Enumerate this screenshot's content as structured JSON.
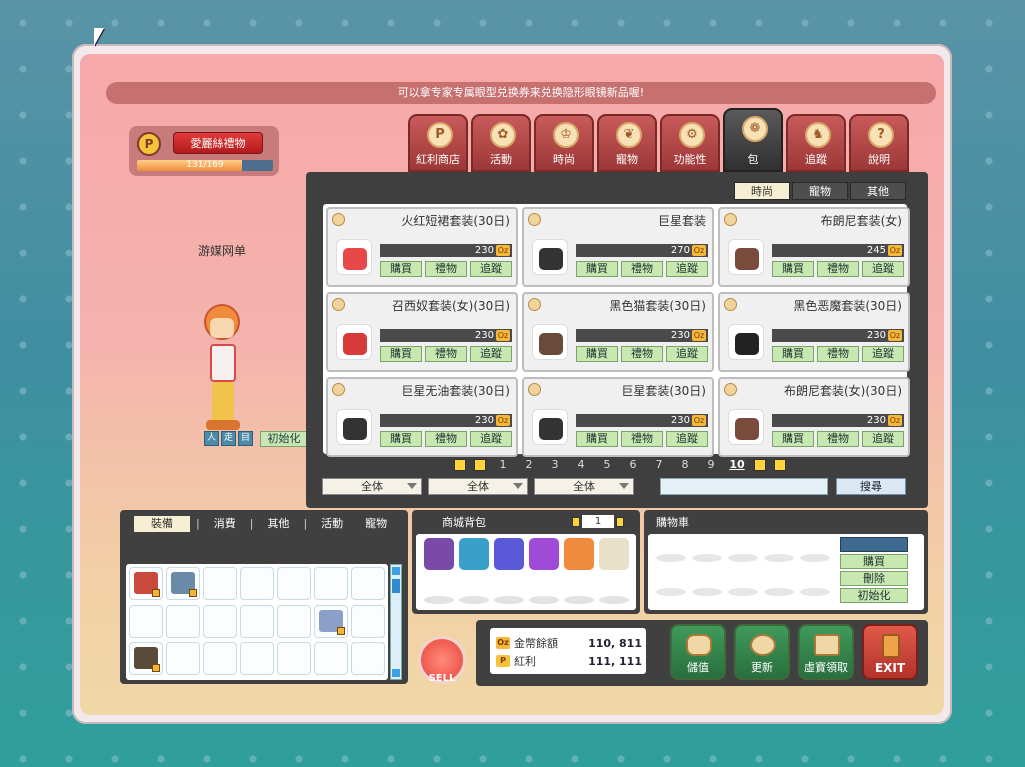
{
  "banner": "可以拿专家专属眼型兑换券来兑换隐形眼镜新品喔!",
  "gift": {
    "badge": "P",
    "label": "愛麗絲禮物",
    "gauge_text": "131/169",
    "gauge_progress": 0.775
  },
  "character": {
    "name": "游媒网单",
    "reset_label": "初始化",
    "controls": [
      "人",
      "走",
      "目"
    ]
  },
  "category_tabs": [
    {
      "label": "紅利商店",
      "glyph": "P"
    },
    {
      "label": "活動",
      "glyph": "✿"
    },
    {
      "label": "時尚",
      "glyph": "♔"
    },
    {
      "label": "寵物",
      "glyph": "❦"
    },
    {
      "label": "功能性",
      "glyph": "⚙"
    },
    {
      "label": "包",
      "glyph": "❁",
      "active": true
    },
    {
      "label": "追蹤",
      "glyph": "♞"
    },
    {
      "label": "說明",
      "glyph": "?"
    }
  ],
  "sub_tabs": [
    {
      "label": "時尚",
      "active": true
    },
    {
      "label": "寵物"
    },
    {
      "label": "其他"
    }
  ],
  "buttons": {
    "buy": "購買",
    "gift": "禮物",
    "track": "追蹤",
    "currency": "Oz"
  },
  "items": [
    {
      "name": "火红短裙套装(30日)",
      "price": "230",
      "color": "#e84848"
    },
    {
      "name": "巨星套装",
      "price": "270",
      "color": "#333333"
    },
    {
      "name": "布朗尼套装(女)",
      "price": "245",
      "color": "#7a4a3a"
    },
    {
      "name": "召西奴套装(女)(30日)",
      "price": "230",
      "color": "#d83a3a"
    },
    {
      "name": "黑色猫套装(30日)",
      "price": "230",
      "color": "#6a4a3a"
    },
    {
      "name": "黑色恶魔套装(30日)",
      "price": "230",
      "color": "#222222"
    },
    {
      "name": "巨星无油套装(30日)",
      "price": "230",
      "color": "#333333"
    },
    {
      "name": "巨星套装(30日)",
      "price": "230",
      "color": "#333333"
    },
    {
      "name": "布朗尼套装(女)(30日)",
      "price": "230",
      "color": "#7a4a3a"
    }
  ],
  "pager": {
    "pages": [
      "1",
      "2",
      "3",
      "4",
      "5",
      "6",
      "7",
      "8",
      "9",
      "10"
    ],
    "current": "10"
  },
  "filters": [
    "全体",
    "全体",
    "全体"
  ],
  "search": {
    "value": "",
    "button": "搜尋"
  },
  "inventory": {
    "tabs": [
      {
        "label": "裝備",
        "active": true
      },
      {
        "label": "消費"
      },
      {
        "label": "其他"
      },
      {
        "label": "活動"
      },
      {
        "label": "寵物"
      }
    ],
    "slots": [
      {
        "color": "#c94a3a"
      },
      {
        "color": "#6a8aa8"
      },
      {},
      {},
      {},
      {},
      {},
      {},
      {},
      {},
      {},
      {},
      {
        "color": "#8aa0c8"
      },
      {},
      {
        "color": "#5a4a3a"
      },
      {},
      {},
      {},
      {},
      {},
      {}
    ]
  },
  "bag": {
    "title": "商城背包",
    "page": "1",
    "items": [
      "#7a4aa8",
      "#3aa0c8",
      "#5a5ad8",
      "#a04ad8",
      "#f08a3c",
      "#e8e0c8"
    ]
  },
  "cart": {
    "title": "購物車",
    "buy": "購買",
    "delete": "刪除",
    "reset": "初始化"
  },
  "wallet": {
    "gold_label": "金幣餘額",
    "gold_value": "110, 811",
    "bonus_label": "紅利",
    "bonus_value": "111, 111"
  },
  "actions": {
    "sell": "SELL",
    "charge": "儲值",
    "refresh": "更新",
    "redeem": "虛寶領取",
    "exit": "EXIT"
  }
}
